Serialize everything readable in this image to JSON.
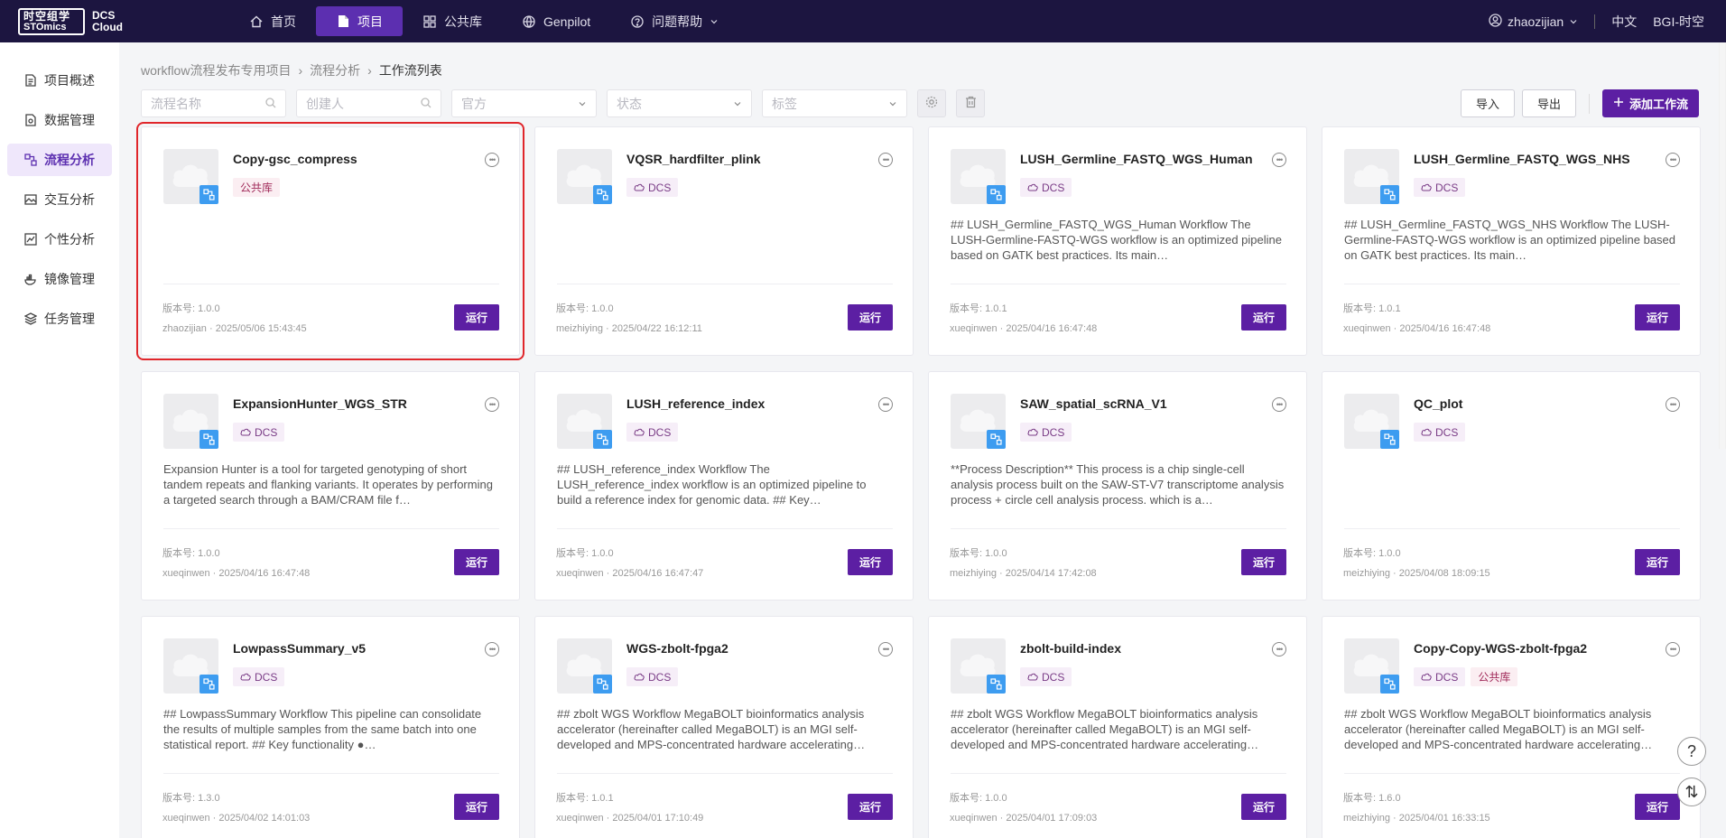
{
  "logo": {
    "brand_cn": "时空组学",
    "brand_en": "STOmics",
    "product": "DCS Cloud"
  },
  "nav": [
    {
      "label": "首页",
      "icon": "home-icon"
    },
    {
      "label": "项目",
      "icon": "document-icon",
      "active": true
    },
    {
      "label": "公共库",
      "icon": "grid-icon"
    },
    {
      "label": "Genpilot",
      "icon": "globe-icon"
    },
    {
      "label": "问题帮助",
      "icon": "help-icon"
    }
  ],
  "user": {
    "name": "zhaozijian",
    "lang": "中文",
    "org": "BGI-时空"
  },
  "sidebar": [
    {
      "label": "项目概述",
      "icon": "doc-icon"
    },
    {
      "label": "数据管理",
      "icon": "data-icon"
    },
    {
      "label": "流程分析",
      "icon": "flow-icon",
      "active": true
    },
    {
      "label": "交互分析",
      "icon": "image-icon"
    },
    {
      "label": "个性分析",
      "icon": "chart-icon"
    },
    {
      "label": "镜像管理",
      "icon": "whale-icon"
    },
    {
      "label": "任务管理",
      "icon": "layers-icon"
    }
  ],
  "breadcrumb": [
    "workflow流程发布专用项目",
    "流程分析",
    "工作流列表"
  ],
  "filters": {
    "name": "流程名称",
    "creator": "创建人",
    "source": "官方",
    "status": "状态",
    "tag": "标签"
  },
  "actions": {
    "import": "导入",
    "export": "导出",
    "add": "添加工作流"
  },
  "run_label": "运行",
  "version_prefix": "版本号:",
  "cards": [
    {
      "title": "Copy-gsc_compress",
      "tags": [
        "公共库"
      ],
      "desc": "",
      "version": "1.0.0",
      "author": "zhaozijian",
      "time": "2025/05/06 15:43:45"
    },
    {
      "title": "VQSR_hardfilter_plink",
      "tags": [
        "DCS"
      ],
      "desc": "",
      "version": "1.0.0",
      "author": "meizhiying",
      "time": "2025/04/22 16:12:11"
    },
    {
      "title": "LUSH_Germline_FASTQ_WGS_Human",
      "tags": [
        "DCS"
      ],
      "desc": "## LUSH_Germline_FASTQ_WGS_Human Workflow The LUSH-Germline-FASTQ-WGS workflow is an optimized pipeline based on GATK best practices. Its main…",
      "version": "1.0.1",
      "author": "xueqinwen",
      "time": "2025/04/16 16:47:48"
    },
    {
      "title": "LUSH_Germline_FASTQ_WGS_NHS",
      "tags": [
        "DCS"
      ],
      "desc": "## LUSH_Germline_FASTQ_WGS_NHS Workflow The LUSH-Germline-FASTQ-WGS workflow is an optimized pipeline based on GATK best practices. Its main…",
      "version": "1.0.1",
      "author": "xueqinwen",
      "time": "2025/04/16 16:47:48"
    },
    {
      "title": "ExpansionHunter_WGS_STR",
      "tags": [
        "DCS"
      ],
      "desc": "Expansion Hunter is a tool for targeted genotyping of short tandem repeats and flanking variants. It operates by performing a targeted search through a BAM/CRAM file f…",
      "version": "1.0.0",
      "author": "xueqinwen",
      "time": "2025/04/16 16:47:48"
    },
    {
      "title": "LUSH_reference_index",
      "tags": [
        "DCS"
      ],
      "desc": "## LUSH_reference_index Workflow The LUSH_reference_index workflow is an optimized pipeline to build a reference index for genomic data. ## Key…",
      "version": "1.0.0",
      "author": "xueqinwen",
      "time": "2025/04/16 16:47:47"
    },
    {
      "title": "SAW_spatial_scRNA_V1",
      "tags": [
        "DCS"
      ],
      "desc": "**Process Description** This process is a chip single-cell analysis process built on the SAW-ST-V7 transcriptome analysis process + circle cell analysis process. which is a…",
      "version": "1.0.0",
      "author": "meizhiying",
      "time": "2025/04/14 17:42:08"
    },
    {
      "title": "QC_plot",
      "tags": [
        "DCS"
      ],
      "desc": "",
      "version": "1.0.0",
      "author": "meizhiying",
      "time": "2025/04/08 18:09:15"
    },
    {
      "title": "LowpassSummary_v5",
      "tags": [
        "DCS"
      ],
      "desc": "## LowpassSummary Workflow This pipeline can consolidate the results of multiple samples from the same batch into one statistical report. ## Key functionality ●…",
      "version": "1.3.0",
      "author": "xueqinwen",
      "time": "2025/04/02 14:01:03"
    },
    {
      "title": "WGS-zbolt-fpga2",
      "tags": [
        "DCS"
      ],
      "desc": "## zbolt WGS Workflow MegaBOLT bioinformatics analysis accelerator (hereinafter called MegaBOLT) is an MGI self-developed and MPS-concentrated hardware accelerating…",
      "version": "1.0.1",
      "author": "xueqinwen",
      "time": "2025/04/01 17:10:49"
    },
    {
      "title": "zbolt-build-index",
      "tags": [
        "DCS"
      ],
      "desc": "## zbolt WGS Workflow MegaBOLT bioinformatics analysis accelerator (hereinafter called MegaBOLT) is an MGI self-developed and MPS-concentrated hardware accelerating…",
      "version": "1.0.0",
      "author": "xueqinwen",
      "time": "2025/04/01 17:09:03"
    },
    {
      "title": "Copy-Copy-WGS-zbolt-fpga2",
      "tags": [
        "DCS",
        "公共库"
      ],
      "desc": "## zbolt WGS Workflow MegaBOLT bioinformatics analysis accelerator (hereinafter called MegaBOLT) is an MGI self-developed and MPS-concentrated hardware accelerating…",
      "version": "1.6.0",
      "author": "meizhiying",
      "time": "2025/04/01 16:33:15"
    }
  ],
  "float": {
    "help": "?",
    "sort": "⇅"
  }
}
